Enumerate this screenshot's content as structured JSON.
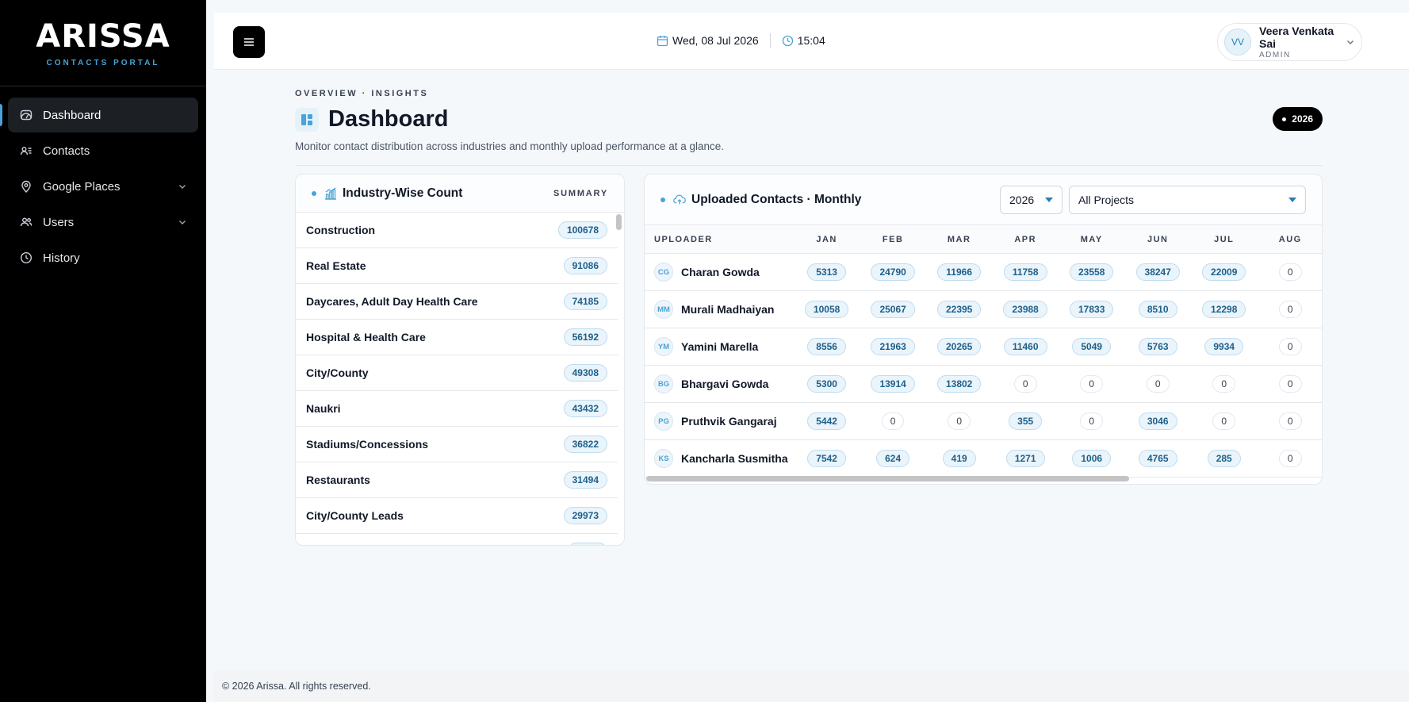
{
  "brand": {
    "name": "ARISSA",
    "subtitle": "CONTACTS PORTAL"
  },
  "sidebar": {
    "items": [
      {
        "label": "Dashboard",
        "icon": "dashboard-gauge-icon",
        "active": true
      },
      {
        "label": "Contacts",
        "icon": "contacts-card-icon"
      },
      {
        "label": "Google Places",
        "icon": "map-pin-icon",
        "expandable": true
      },
      {
        "label": "Users",
        "icon": "users-icon",
        "expandable": true
      },
      {
        "label": "History",
        "icon": "clock-icon"
      }
    ]
  },
  "topbar": {
    "date": "Wed, 08 Jul 2026",
    "time": "15:04",
    "user": {
      "initials": "VV",
      "name": "Veera Venkata Sai",
      "role": "ADMIN"
    }
  },
  "page": {
    "eyebrow": "OVERVIEW · INSIGHTS",
    "title": "Dashboard",
    "subtitle": "Monitor contact distribution across industries and monthly upload performance at a glance.",
    "year_badge": "2026"
  },
  "industry": {
    "title": "Industry-Wise Count",
    "summary_label": "SUMMARY",
    "rows": [
      {
        "name": "Construction",
        "count": "100678"
      },
      {
        "name": "Real Estate",
        "count": "91086"
      },
      {
        "name": "Daycares, Adult Day Health Care",
        "count": "74185"
      },
      {
        "name": "Hospital & Health Care",
        "count": "56192"
      },
      {
        "name": "City/County",
        "count": "49308"
      },
      {
        "name": "Naukri",
        "count": "43432"
      },
      {
        "name": "Stadiums/Concessions",
        "count": "36822"
      },
      {
        "name": "Restaurants",
        "count": "31494"
      },
      {
        "name": "City/County Leads",
        "count": "29973"
      }
    ]
  },
  "uploads": {
    "title": "Uploaded Contacts · Monthly",
    "year_select": "2026",
    "project_select": "All Projects",
    "columns": [
      "UPLOADER",
      "JAN",
      "FEB",
      "MAR",
      "APR",
      "MAY",
      "JUN",
      "JUL",
      "AUG"
    ],
    "rows": [
      {
        "initials": "CG",
        "name": "Charan Gowda",
        "values": [
          "5313",
          "24790",
          "11966",
          "11758",
          "23558",
          "38247",
          "22009",
          "0"
        ]
      },
      {
        "initials": "MM",
        "name": "Murali Madhaiyan",
        "values": [
          "10058",
          "25067",
          "22395",
          "23988",
          "17833",
          "8510",
          "12298",
          "0"
        ]
      },
      {
        "initials": "YM",
        "name": "Yamini Marella",
        "values": [
          "8556",
          "21963",
          "20265",
          "11460",
          "5049",
          "5763",
          "9934",
          "0"
        ]
      },
      {
        "initials": "BG",
        "name": "Bhargavi Gowda",
        "values": [
          "5300",
          "13914",
          "13802",
          "0",
          "0",
          "0",
          "0",
          "0"
        ]
      },
      {
        "initials": "PG",
        "name": "Pruthvik Gangaraj",
        "values": [
          "5442",
          "0",
          "0",
          "355",
          "0",
          "3046",
          "0",
          "0"
        ]
      },
      {
        "initials": "KS",
        "name": "Kancharla Susmitha",
        "values": [
          "7542",
          "624",
          "419",
          "1271",
          "1006",
          "4765",
          "285",
          "0"
        ]
      }
    ]
  },
  "footer": {
    "text": "© 2026 Arissa. All rights reserved."
  },
  "colors": {
    "accent": "#4aa3d8",
    "sidebar_bg": "#000000",
    "pill_bg": "#eaf4fb"
  }
}
